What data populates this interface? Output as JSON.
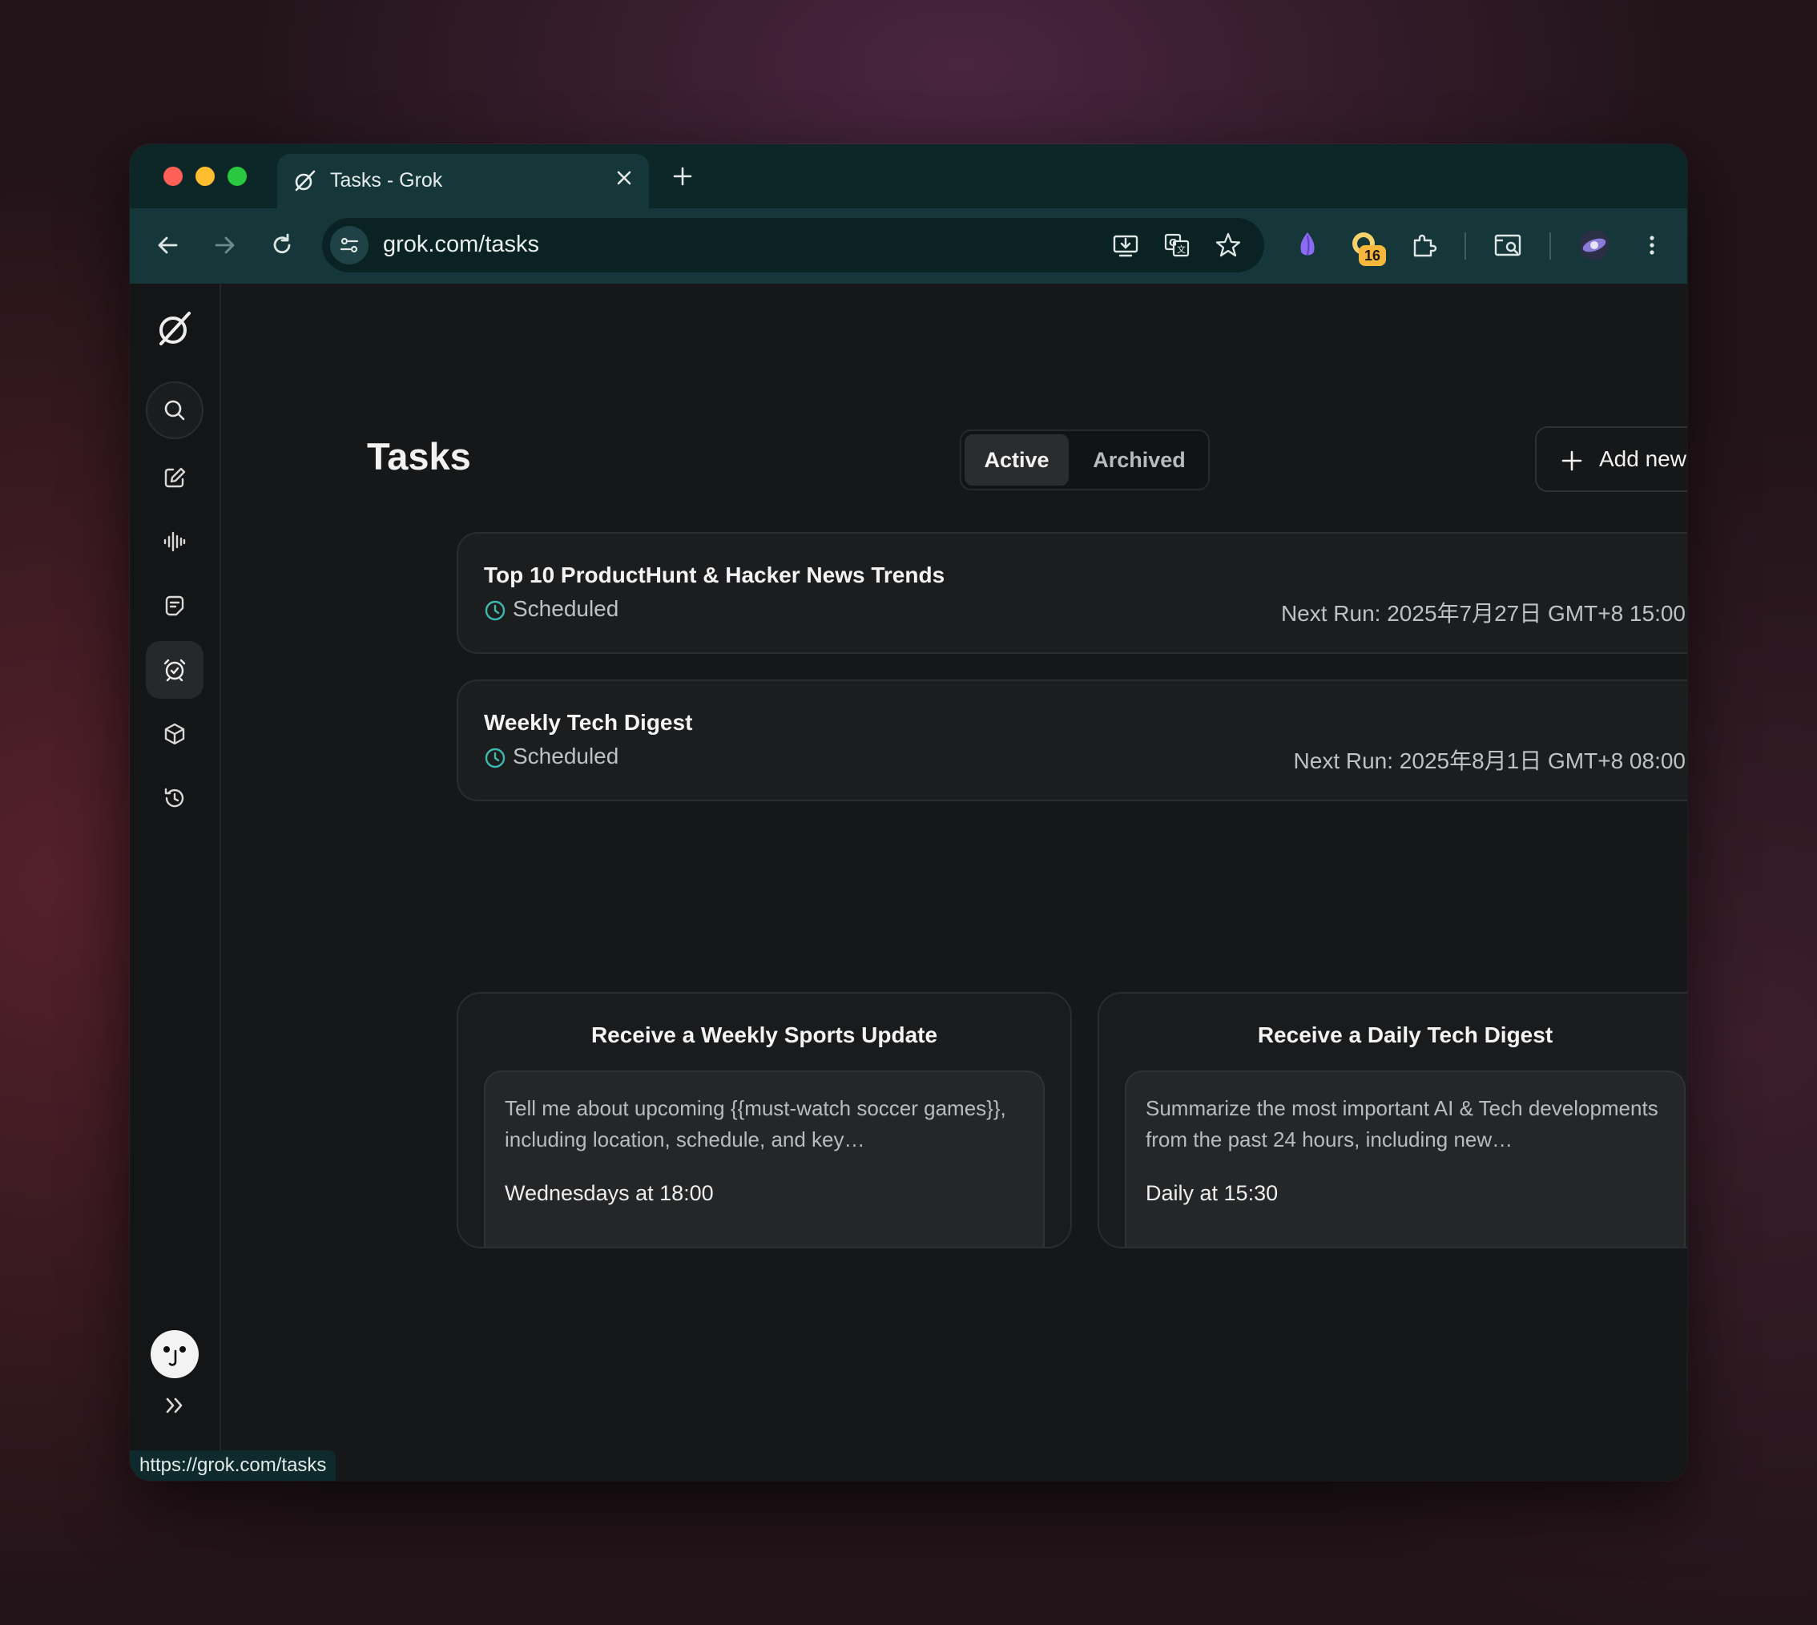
{
  "browser": {
    "tab_title": "Tasks - Grok",
    "url": "grok.com/tasks",
    "status_url": "https://grok.com/tasks",
    "extension_badge": "16",
    "colors": {
      "frame": "#0d2628",
      "toolbar": "#16373a",
      "omnibox": "#0b2224"
    }
  },
  "sidebar": {
    "items": [
      {
        "name": "search"
      },
      {
        "name": "new-chat"
      },
      {
        "name": "voice"
      },
      {
        "name": "files"
      },
      {
        "name": "tasks",
        "active": true
      },
      {
        "name": "projects"
      },
      {
        "name": "history"
      }
    ]
  },
  "page": {
    "title": "Tasks",
    "tabs": {
      "active": "Active",
      "archived": "Archived"
    },
    "add_button": "Add new"
  },
  "tasks": [
    {
      "title": "Top 10 ProductHunt & Hacker News Trends",
      "status": "Scheduled",
      "next_run": "Next Run: 2025年7月27日 GMT+8 15:00"
    },
    {
      "title": "Weekly Tech Digest",
      "status": "Scheduled",
      "next_run": "Next Run: 2025年8月1日 GMT+8 08:00"
    }
  ],
  "suggestions": [
    {
      "title": "Receive a Weekly Sports Update",
      "prompt": "Tell me about upcoming {{must-watch soccer games}}, including location, schedule, and key…",
      "schedule": "Wednesdays at 18:00"
    },
    {
      "title": "Receive a Daily Tech Digest",
      "prompt": "Summarize the most important AI & Tech developments from the past 24 hours, including new…",
      "schedule": "Daily at 15:30"
    }
  ],
  "colors": {
    "accent_teal": "#3fb8b0",
    "background": "#161718",
    "card": "#1c1d1f"
  }
}
